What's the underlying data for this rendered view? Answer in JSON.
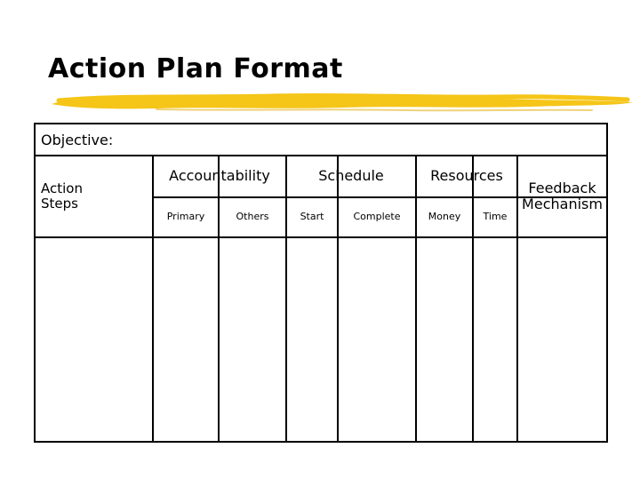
{
  "slide": {
    "title": "Action Plan Format",
    "accent_color": "#F5C518"
  },
  "table": {
    "objective_label": "Objective:",
    "action_steps_label": "Action\nSteps",
    "groups": [
      {
        "label": "Accountability",
        "subs": [
          "Primary",
          "Others"
        ]
      },
      {
        "label": "Schedule",
        "subs": [
          "Start",
          "Complete"
        ]
      },
      {
        "label": "Resources",
        "subs": [
          "Money",
          "Time"
        ]
      },
      {
        "label": "Feedback\nMechanism",
        "subs": []
      }
    ],
    "group_labels": {
      "accountability": "Accountability",
      "schedule": "Schedule",
      "resources": "Resources",
      "feedback": "Feedback Mechanism"
    },
    "sub_labels": {
      "primary": "Primary",
      "others": "Others",
      "start": "Start",
      "complete": "Complete",
      "money": "Money",
      "time": "Time"
    }
  }
}
